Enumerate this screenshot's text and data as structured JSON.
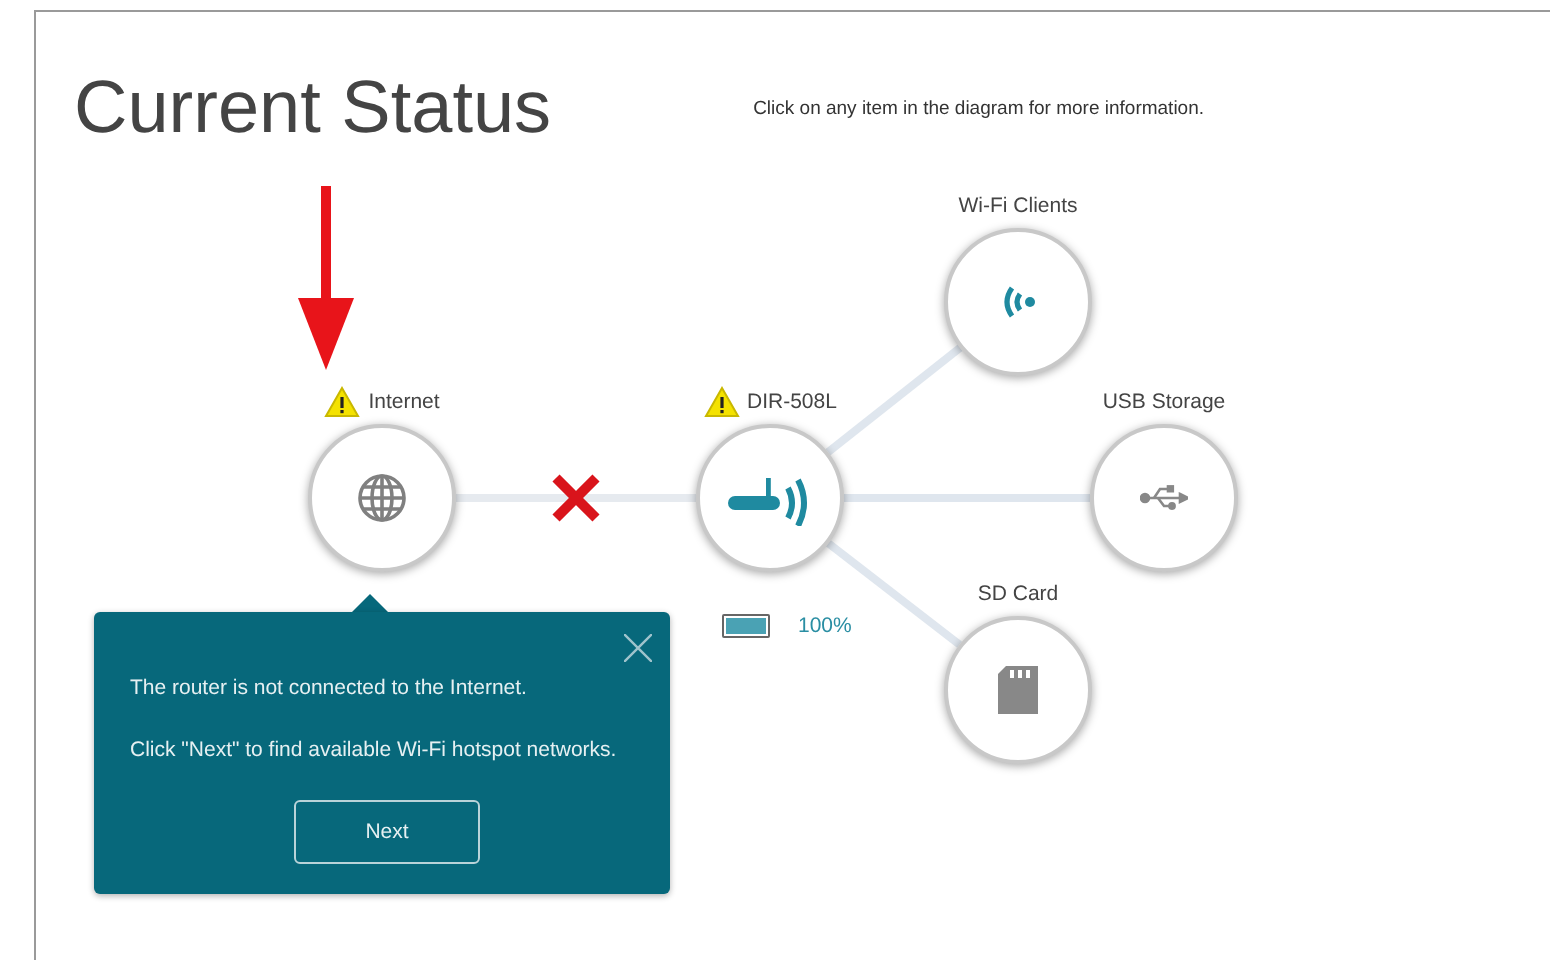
{
  "page": {
    "title": "Current Status",
    "hint": "Click on any item in the diagram for more information."
  },
  "diagram": {
    "nodes": [
      {
        "kind": "internet",
        "label": "Internet",
        "warning": true,
        "connected": false
      },
      {
        "kind": "router",
        "label": "DIR-508L",
        "warning": true,
        "battery": {
          "level": 1,
          "reading": "100%"
        }
      },
      {
        "kind": "wifi_clients",
        "label": "Wi-Fi Clients",
        "warning": false,
        "connected": true
      },
      {
        "kind": "usb_storage",
        "label": "USB Storage",
        "warning": false,
        "connected": true
      },
      {
        "kind": "sd_card",
        "label": "SD Card",
        "warning": false,
        "connected": true
      }
    ]
  },
  "popup": {
    "messages": [
      "The router is not connected to the Internet.",
      "Click \"Next\" to find available Wi-Fi hotspot networks."
    ],
    "button": "Next"
  }
}
